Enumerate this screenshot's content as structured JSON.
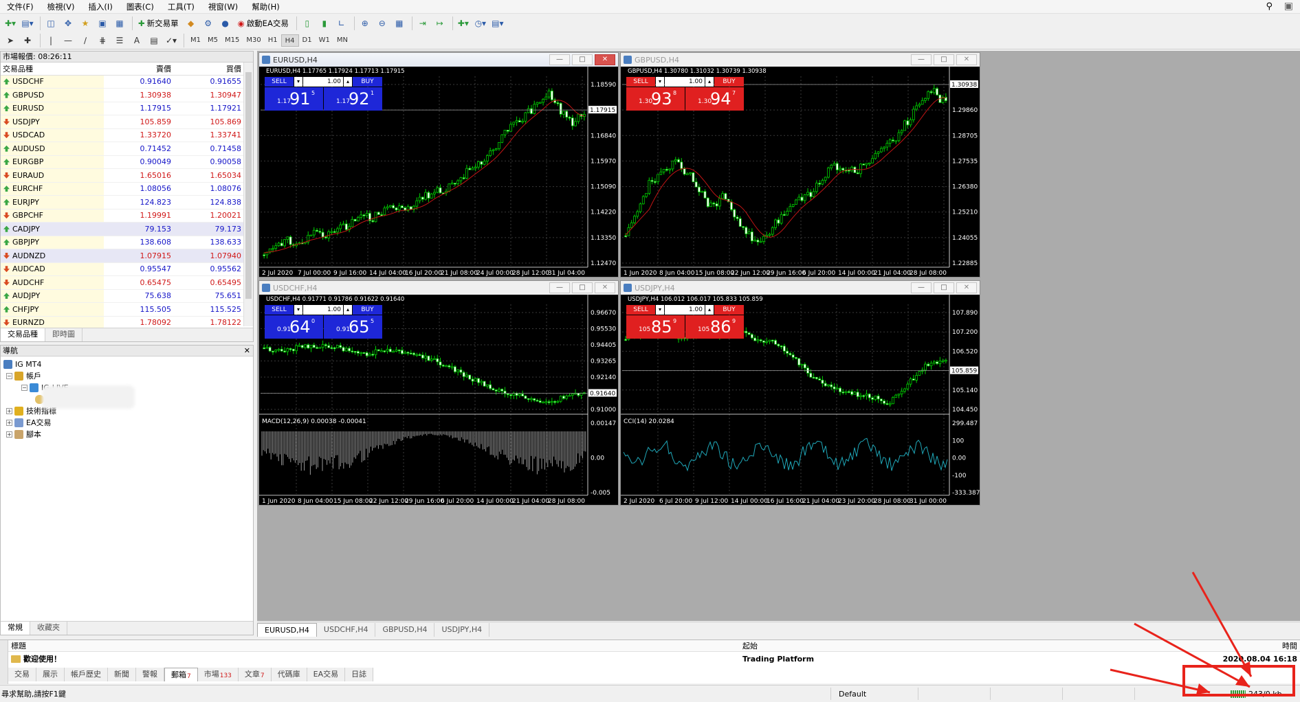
{
  "menu": [
    "文件(F)",
    "檢視(V)",
    "插入(I)",
    "圖表(C)",
    "工具(T)",
    "視窗(W)",
    "幫助(H)"
  ],
  "toolbar": {
    "new_order": "新交易單",
    "start_ea": "啟動EA交易"
  },
  "timeframes": [
    "M1",
    "M5",
    "M15",
    "M30",
    "H1",
    "H4",
    "D1",
    "W1",
    "MN"
  ],
  "active_timeframe": "H4",
  "market_watch": {
    "title": "市場報價: 08:26:11",
    "col_symbol": "交易品種",
    "col_bid": "賣價",
    "col_ask": "買價",
    "rows": [
      {
        "symbol": "USDCHF",
        "bid": "0.91640",
        "ask": "0.91655",
        "dir": "up",
        "color": "blue"
      },
      {
        "symbol": "GBPUSD",
        "bid": "1.30938",
        "ask": "1.30947",
        "dir": "up",
        "color": "red"
      },
      {
        "symbol": "EURUSD",
        "bid": "1.17915",
        "ask": "1.17921",
        "dir": "up",
        "color": "blue"
      },
      {
        "symbol": "USDJPY",
        "bid": "105.859",
        "ask": "105.869",
        "dir": "dn",
        "color": "red"
      },
      {
        "symbol": "USDCAD",
        "bid": "1.33720",
        "ask": "1.33741",
        "dir": "dn",
        "color": "red"
      },
      {
        "symbol": "AUDUSD",
        "bid": "0.71452",
        "ask": "0.71458",
        "dir": "up",
        "color": "blue"
      },
      {
        "symbol": "EURGBP",
        "bid": "0.90049",
        "ask": "0.90058",
        "dir": "up",
        "color": "blue"
      },
      {
        "symbol": "EURAUD",
        "bid": "1.65016",
        "ask": "1.65034",
        "dir": "dn",
        "color": "red"
      },
      {
        "symbol": "EURCHF",
        "bid": "1.08056",
        "ask": "1.08076",
        "dir": "up",
        "color": "blue"
      },
      {
        "symbol": "EURJPY",
        "bid": "124.823",
        "ask": "124.838",
        "dir": "up",
        "color": "blue"
      },
      {
        "symbol": "GBPCHF",
        "bid": "1.19991",
        "ask": "1.20021",
        "dir": "dn",
        "color": "red"
      },
      {
        "symbol": "CADJPY",
        "bid": "79.153",
        "ask": "79.173",
        "dir": "up",
        "color": "blue"
      },
      {
        "symbol": "GBPJPY",
        "bid": "138.608",
        "ask": "138.633",
        "dir": "up",
        "color": "blue"
      },
      {
        "symbol": "AUDNZD",
        "bid": "1.07915",
        "ask": "1.07940",
        "dir": "dn",
        "color": "red"
      },
      {
        "symbol": "AUDCAD",
        "bid": "0.95547",
        "ask": "0.95562",
        "dir": "dn",
        "color": "blue"
      },
      {
        "symbol": "AUDCHF",
        "bid": "0.65475",
        "ask": "0.65495",
        "dir": "dn",
        "color": "red"
      },
      {
        "symbol": "AUDJPY",
        "bid": "75.638",
        "ask": "75.651",
        "dir": "up",
        "color": "blue"
      },
      {
        "symbol": "CHFJPY",
        "bid": "115.505",
        "ask": "115.525",
        "dir": "up",
        "color": "blue"
      },
      {
        "symbol": "EURNZD",
        "bid": "1.78092",
        "ask": "1.78122",
        "dir": "dn",
        "color": "red"
      }
    ],
    "tabs": [
      "交易品種",
      "即時圖"
    ]
  },
  "navigator": {
    "title": "導航",
    "root": "IG MT4",
    "accounts": "帳戶",
    "account_item": "IG-LIVE",
    "indicators": "技術指標",
    "experts": "EA交易",
    "scripts": "腳本",
    "tabs": [
      "常規",
      "收藏夾"
    ]
  },
  "charts": [
    {
      "id": "eurusd",
      "title": "EURUSD,H4",
      "info": "EURUSD,H4  1.17765 1.17924 1.17713 1.17915",
      "active": true,
      "sell_label": "SELL",
      "buy_label": "BUY",
      "lot": "1.00",
      "theme": "blue",
      "sell_small": "1.17",
      "sell_big": "91",
      "sell_sup": "5",
      "buy_small": "1.17",
      "buy_big": "92",
      "buy_sup": "1",
      "price_axis": [
        "1.18590",
        "1.17915",
        "1.16840",
        "1.15970",
        "1.15090",
        "1.14220",
        "1.13350",
        "1.12470"
      ],
      "current": "1.17915",
      "time_axis": [
        "2 Jul 2020",
        "7 Jul 00:00",
        "9 Jul 16:00",
        "14 Jul 04:00",
        "16 Jul 20:00",
        "21 Jul 08:00",
        "24 Jul 00:00",
        "28 Jul 12:00",
        "31 Jul 04:00"
      ]
    },
    {
      "id": "gbpusd",
      "title": "GBPUSD,H4",
      "info": "GBPUSD,H4  1.30780 1.31032 1.30739 1.30938",
      "active": false,
      "sell_label": "SELL",
      "buy_label": "BUY",
      "lot": "1.00",
      "theme": "red",
      "sell_small": "1.30",
      "sell_big": "93",
      "sell_sup": "8",
      "buy_small": "1.30",
      "buy_big": "94",
      "buy_sup": "7",
      "price_axis": [
        "1.30938",
        "1.29860",
        "1.28705",
        "1.27535",
        "1.26380",
        "1.25210",
        "1.24055",
        "1.22885"
      ],
      "current": "1.30938",
      "time_axis": [
        "1 Jun 2020",
        "8 Jun 04:00",
        "15 Jun 08:00",
        "22 Jun 12:00",
        "29 Jun 16:00",
        "6 Jul 20:00",
        "14 Jul 00:00",
        "21 Jul 04:00",
        "28 Jul 08:00"
      ]
    },
    {
      "id": "usdchf",
      "title": "USDCHF,H4",
      "info": "USDCHF,H4  0.91771 0.91786 0.91622 0.91640",
      "active": false,
      "sell_label": "SELL",
      "buy_label": "BUY",
      "lot": "1.00",
      "theme": "blue",
      "sell_small": "0.91",
      "sell_big": "64",
      "sell_sup": "0",
      "buy_small": "0.91",
      "buy_big": "65",
      "buy_sup": "5",
      "price_axis": [
        "0.96670",
        "0.95530",
        "0.94405",
        "0.93265",
        "0.92140",
        "0.91640",
        "0.91000"
      ],
      "current": "0.91640",
      "sub_title": "MACD(12,26,9) 0.00038 -0.00041",
      "sub_axis": [
        "0.00147",
        "0.00",
        "-0.005"
      ],
      "time_axis": [
        "1 Jun 2020",
        "8 Jun 04:00",
        "15 Jun 08:00",
        "22 Jun 12:00",
        "29 Jun 16:00",
        "6 Jul 20:00",
        "14 Jul 00:00",
        "21 Jul 04:00",
        "28 Jul 08:00"
      ]
    },
    {
      "id": "usdjpy",
      "title": "USDJPY,H4",
      "info": "USDJPY,H4  106.012 106.017 105.833 105.859",
      "active": false,
      "sell_label": "SELL",
      "buy_label": "BUY",
      "lot": "1.00",
      "theme": "red",
      "sell_small": "105",
      "sell_big": "85",
      "sell_sup": "9",
      "buy_small": "105",
      "buy_big": "86",
      "buy_sup": "9",
      "price_axis": [
        "107.890",
        "107.200",
        "106.520",
        "105.859",
        "105.140",
        "104.450"
      ],
      "current": "105.859",
      "sub_title": "CCI(14) 20.0284",
      "sub_axis": [
        "299.487",
        "100",
        "0.00",
        "-100",
        "-333.387"
      ],
      "time_axis": [
        "2 Jul 2020",
        "6 Jul 20:00",
        "9 Jul 12:00",
        "14 Jul 00:00",
        "16 Jul 16:00",
        "21 Jul 04:00",
        "23 Jul 20:00",
        "28 Jul 08:00",
        "31 Jul 00:00"
      ]
    }
  ],
  "chart_tabs": [
    "EURUSD,H4",
    "USDCHF,H4",
    "GBPUSD,H4",
    "USDJPY,H4"
  ],
  "terminal": {
    "col_title": "標題",
    "col_from": "起始",
    "col_time": "時間",
    "row_title": "歡迎使用！",
    "row_from": "Trading Platform",
    "row_time": "2020.08.04 16:18",
    "tabs": [
      {
        "label": "交易",
        "badge": ""
      },
      {
        "label": "展示",
        "badge": ""
      },
      {
        "label": "帳戶歷史",
        "badge": ""
      },
      {
        "label": "新聞",
        "badge": ""
      },
      {
        "label": "警報",
        "badge": ""
      },
      {
        "label": "郵箱",
        "badge": "7"
      },
      {
        "label": "市場",
        "badge": "133"
      },
      {
        "label": "文章",
        "badge": "7"
      },
      {
        "label": "代碼庫",
        "badge": ""
      },
      {
        "label": "EA交易",
        "badge": ""
      },
      {
        "label": "日誌",
        "badge": ""
      }
    ]
  },
  "status": {
    "help": "尋求幫助,請按F1鍵",
    "profile": "Default",
    "traffic": "243/0 kb"
  },
  "colors": {
    "bull": "#00d000",
    "bear": "#00d000",
    "ma": "#c01515",
    "sell_blue": "#1e27d8",
    "buy_blue": "#1e27d8",
    "sell_red": "#e02020",
    "annotation": "#e8231b"
  }
}
